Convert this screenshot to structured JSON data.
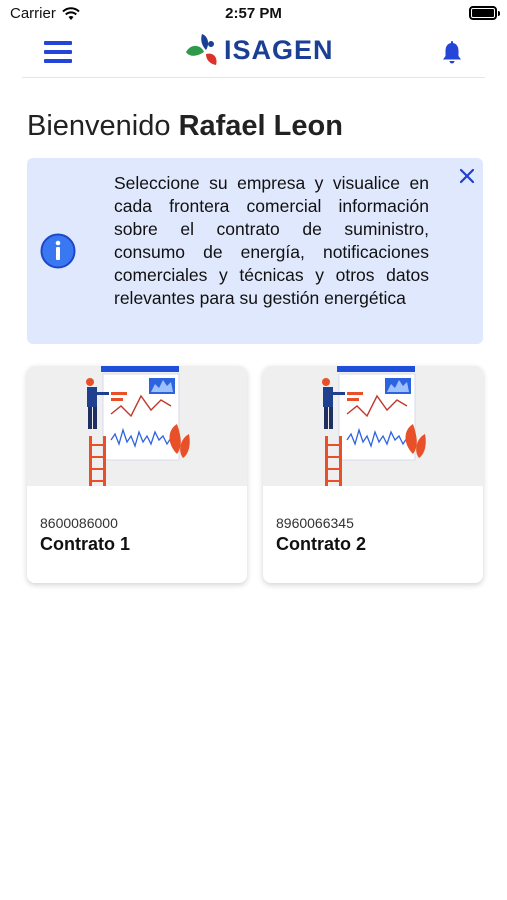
{
  "status_bar": {
    "carrier": "Carrier",
    "time": "2:57 PM"
  },
  "header": {
    "brand": "ISAGEN"
  },
  "welcome": {
    "greeting": "Bienvenido",
    "user_name": "Rafael Leon"
  },
  "info_banner": {
    "text": "Seleccione su empresa y visualice en cada frontera comercial información sobre el contrato de suministro, consumo de energía, notificaciones comerciales y técnicas y otros datos relevantes para su gestión energética"
  },
  "contracts": [
    {
      "id": "8600086000",
      "title": "Contrato 1"
    },
    {
      "id": "8960066345",
      "title": "Contrato 2"
    }
  ],
  "colors": {
    "accent": "#2545d9",
    "brand": "#1b3f95",
    "banner_bg": "#dfe8fc",
    "illustration_orange": "#e8502a"
  }
}
